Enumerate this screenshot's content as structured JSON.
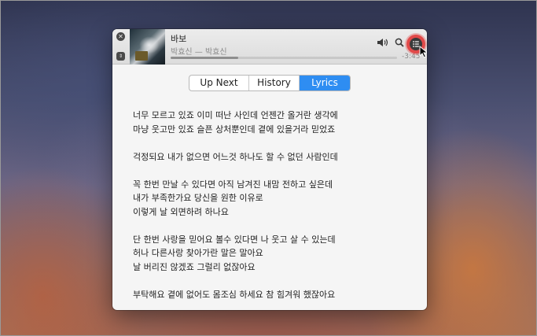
{
  "player": {
    "track_title": "바보",
    "track_artist": "박효신 — 박효신",
    "time_remaining": "-3:45",
    "progress": 0.3
  },
  "tabs": [
    {
      "label": "Up Next",
      "active": false
    },
    {
      "label": "History",
      "active": false
    },
    {
      "label": "Lyrics",
      "active": true
    }
  ],
  "lyrics": {
    "stanzas": [
      [
        "너무 모르고 있죠 이미 떠난 사인데 언젠간 올거란 생각에",
        "마냥 웃고만 있죠 슬픈 상처뿐인데 곁에 있을거라 믿었죠"
      ],
      [
        "걱정되요 내가 없으면 어느것 하나도 할 수 없던 사람인데"
      ],
      [
        "꼭 한번 만날 수 있다면 아직 남겨진 내맘 전하고 싶은데",
        "내가 부족한가요 당신을 원한 이유로",
        "이렇게 날 외면하려 하나요"
      ],
      [
        "단 한번 사랑을 믿어요 볼수 있다면 나 웃고 살 수 있는데",
        "허나 다른사랑 찾아가란 말은 말아요",
        "날 버리진 않겠죠 그럴리 없잖아요"
      ],
      [
        "부탁해요 곁에 없어도 몸조심 하세요 참 힘겨워 했잖아요"
      ]
    ]
  },
  "colors": {
    "accent": "#2e8df2",
    "highlight": "#e24a4a"
  },
  "icons": {
    "close": "close-icon",
    "mini_player": "mini-player-icon",
    "volume": "volume-icon",
    "search": "search-icon",
    "list": "list-icon",
    "cursor": "cursor-icon"
  }
}
